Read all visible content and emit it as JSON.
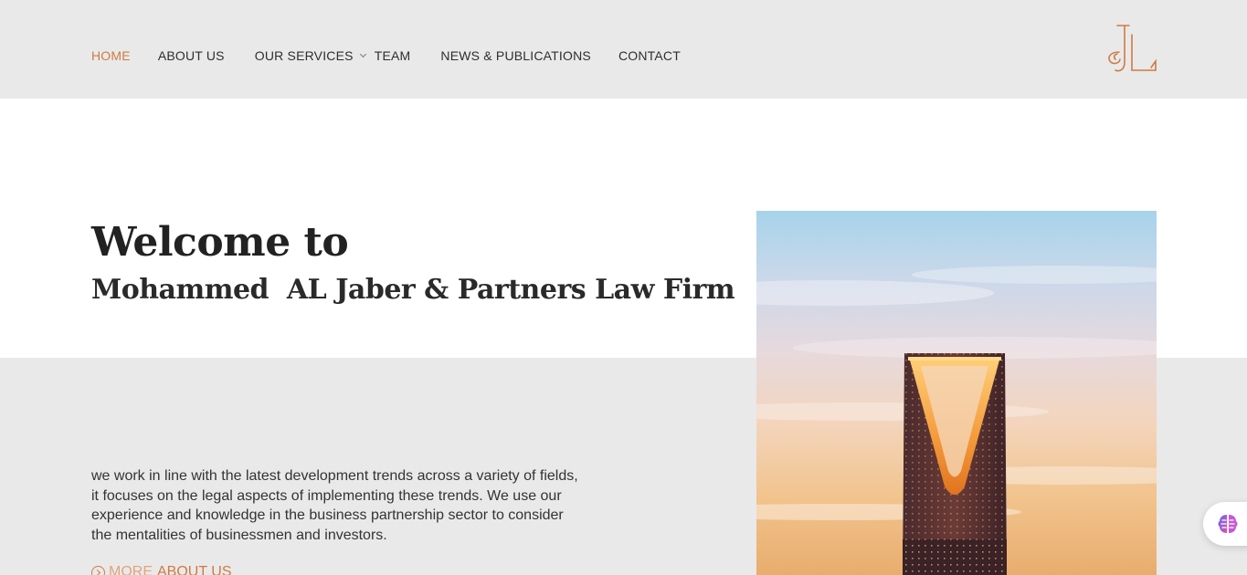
{
  "nav": {
    "items": [
      {
        "label": "HOME",
        "active": true
      },
      {
        "label": "ABOUT US",
        "active": false
      },
      {
        "label": "OUR SERVICES",
        "active": false,
        "has_dropdown": true
      },
      {
        "label": "TEAM",
        "active": false
      },
      {
        "label": "NEWS & PUBLICATIONS",
        "active": false
      },
      {
        "label": "CONTACT",
        "active": false
      }
    ]
  },
  "logo": {
    "icon": "firm-monogram-icon"
  },
  "hero": {
    "welcome": "Welcome to",
    "firm_name": "Mohammed  AL Jaber & Partners Law Firm",
    "intro_lines": [
      "we work in line with the latest development trends across a variety of fields,",
      "it focuses on the legal aspects of implementing these trends. We use our",
      "experience and knowledge in the business partnership sector to consider",
      "the mentalities of businessmen and investors."
    ],
    "more_prefix": "MORE",
    "more_link": "ABOUT US"
  },
  "assistant": {
    "icon": "brain-icon"
  },
  "colors": {
    "accent": "#d07a43",
    "header_bg": "#e9e9e9",
    "text": "#2e2e2e"
  }
}
